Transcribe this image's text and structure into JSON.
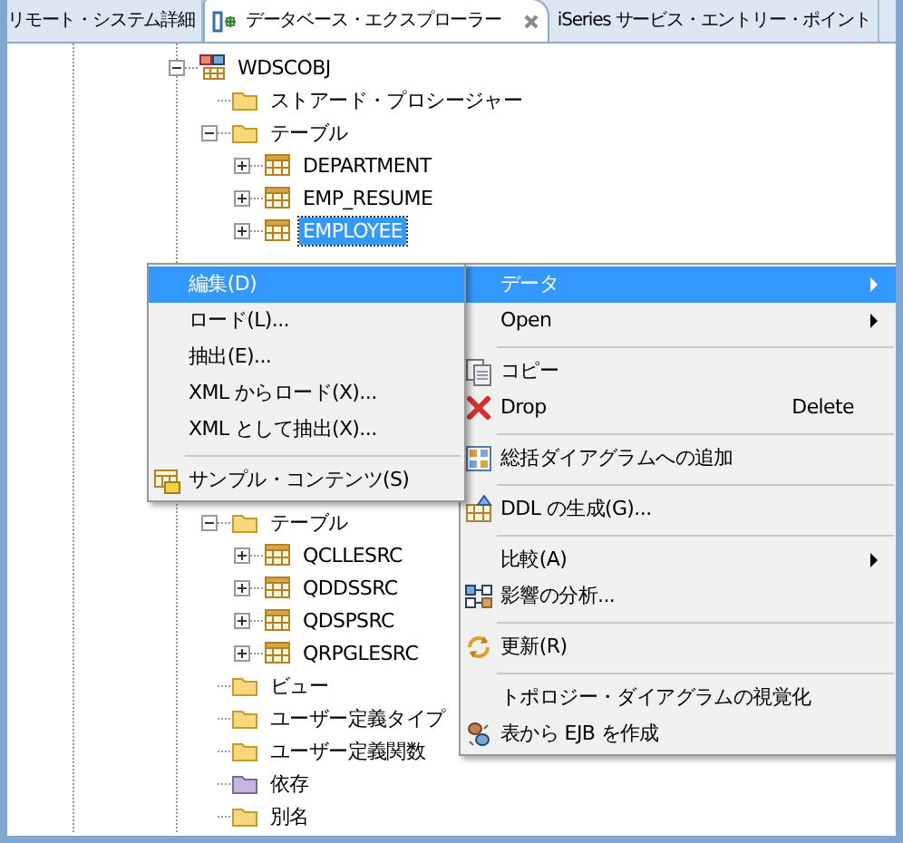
{
  "tabs": [
    {
      "label": "リモート・システム詳細",
      "selected": false
    },
    {
      "label": "データベース・エクスプローラー",
      "selected": true
    },
    {
      "label": "iSeries サービス・エントリー・ポイント",
      "selected": false
    }
  ],
  "tree_top": [
    {
      "label": "WDSCOBJ",
      "kind": "schema",
      "expanded": true,
      "selected": false,
      "children": [
        {
          "label": "ストアード・プロシージャー",
          "kind": "folder",
          "selected": false
        },
        {
          "label": "テーブル",
          "kind": "folder",
          "expanded": true,
          "selected": false,
          "children": [
            {
              "label": "DEPARTMENT",
              "kind": "table",
              "expanded": false,
              "selected": false
            },
            {
              "label": "EMP_RESUME",
              "kind": "table",
              "expanded": false,
              "selected": false
            },
            {
              "label": "EMPLOYEE",
              "kind": "table",
              "expanded": false,
              "selected": true
            }
          ]
        }
      ]
    }
  ],
  "tree_bottom": [
    {
      "label": "テーブル",
      "kind": "folder",
      "expanded": true,
      "selected": false,
      "children": [
        {
          "label": "QCLLESRC",
          "kind": "table",
          "expanded": false,
          "selected": false
        },
        {
          "label": "QDDSSRC",
          "kind": "table",
          "expanded": false,
          "selected": false
        },
        {
          "label": "QDSPSRC",
          "kind": "table",
          "expanded": false,
          "selected": false
        },
        {
          "label": "QRPGLESRC",
          "kind": "table",
          "expanded": false,
          "selected": false
        }
      ]
    },
    {
      "label": "ビュー",
      "kind": "folder",
      "selected": false
    },
    {
      "label": "ユーザー定義タイプ",
      "kind": "folder",
      "selected": false
    },
    {
      "label": "ユーザー定義関数",
      "kind": "folder",
      "selected": false
    },
    {
      "label": "依存",
      "kind": "dependency",
      "selected": false
    },
    {
      "label": "別名",
      "kind": "folder",
      "selected": false
    }
  ],
  "context_menu": [
    {
      "kind": "item",
      "label": "データ",
      "submenu": true,
      "selected": true
    },
    {
      "kind": "item",
      "label": "Open",
      "submenu": true,
      "selected": false
    },
    {
      "kind": "separator"
    },
    {
      "kind": "item",
      "label": "コピー",
      "selected": false
    },
    {
      "kind": "item",
      "label": "Drop",
      "shortcut": "Delete",
      "selected": false
    },
    {
      "kind": "separator"
    },
    {
      "kind": "item",
      "label": "総括ダイアグラムへの追加",
      "selected": false
    },
    {
      "kind": "separator"
    },
    {
      "kind": "item",
      "label": "DDL の生成(G)...",
      "selected": false
    },
    {
      "kind": "separator"
    },
    {
      "kind": "item",
      "label": "比較(A)",
      "submenu": true,
      "selected": false
    },
    {
      "kind": "item",
      "label": "影響の分析...",
      "selected": false
    },
    {
      "kind": "separator"
    },
    {
      "kind": "item",
      "label": "更新(R)",
      "selected": false
    },
    {
      "kind": "separator"
    },
    {
      "kind": "item",
      "label": "トポロジー・ダイアグラムの視覚化",
      "selected": false
    },
    {
      "kind": "item",
      "label": "表から EJB を作成",
      "selected": false
    }
  ],
  "submenu": [
    {
      "kind": "item",
      "label": "編集(D)",
      "selected": true
    },
    {
      "kind": "item",
      "label": "ロード(L)...",
      "selected": false
    },
    {
      "kind": "item",
      "label": "抽出(E)...",
      "selected": false
    },
    {
      "kind": "item",
      "label": "XML からロード(X)...",
      "selected": false
    },
    {
      "kind": "item",
      "label": "XML として抽出(X)...",
      "selected": false
    },
    {
      "kind": "separator"
    },
    {
      "kind": "item",
      "label": "サンプル・コンテンツ(S)",
      "selected": false
    }
  ]
}
